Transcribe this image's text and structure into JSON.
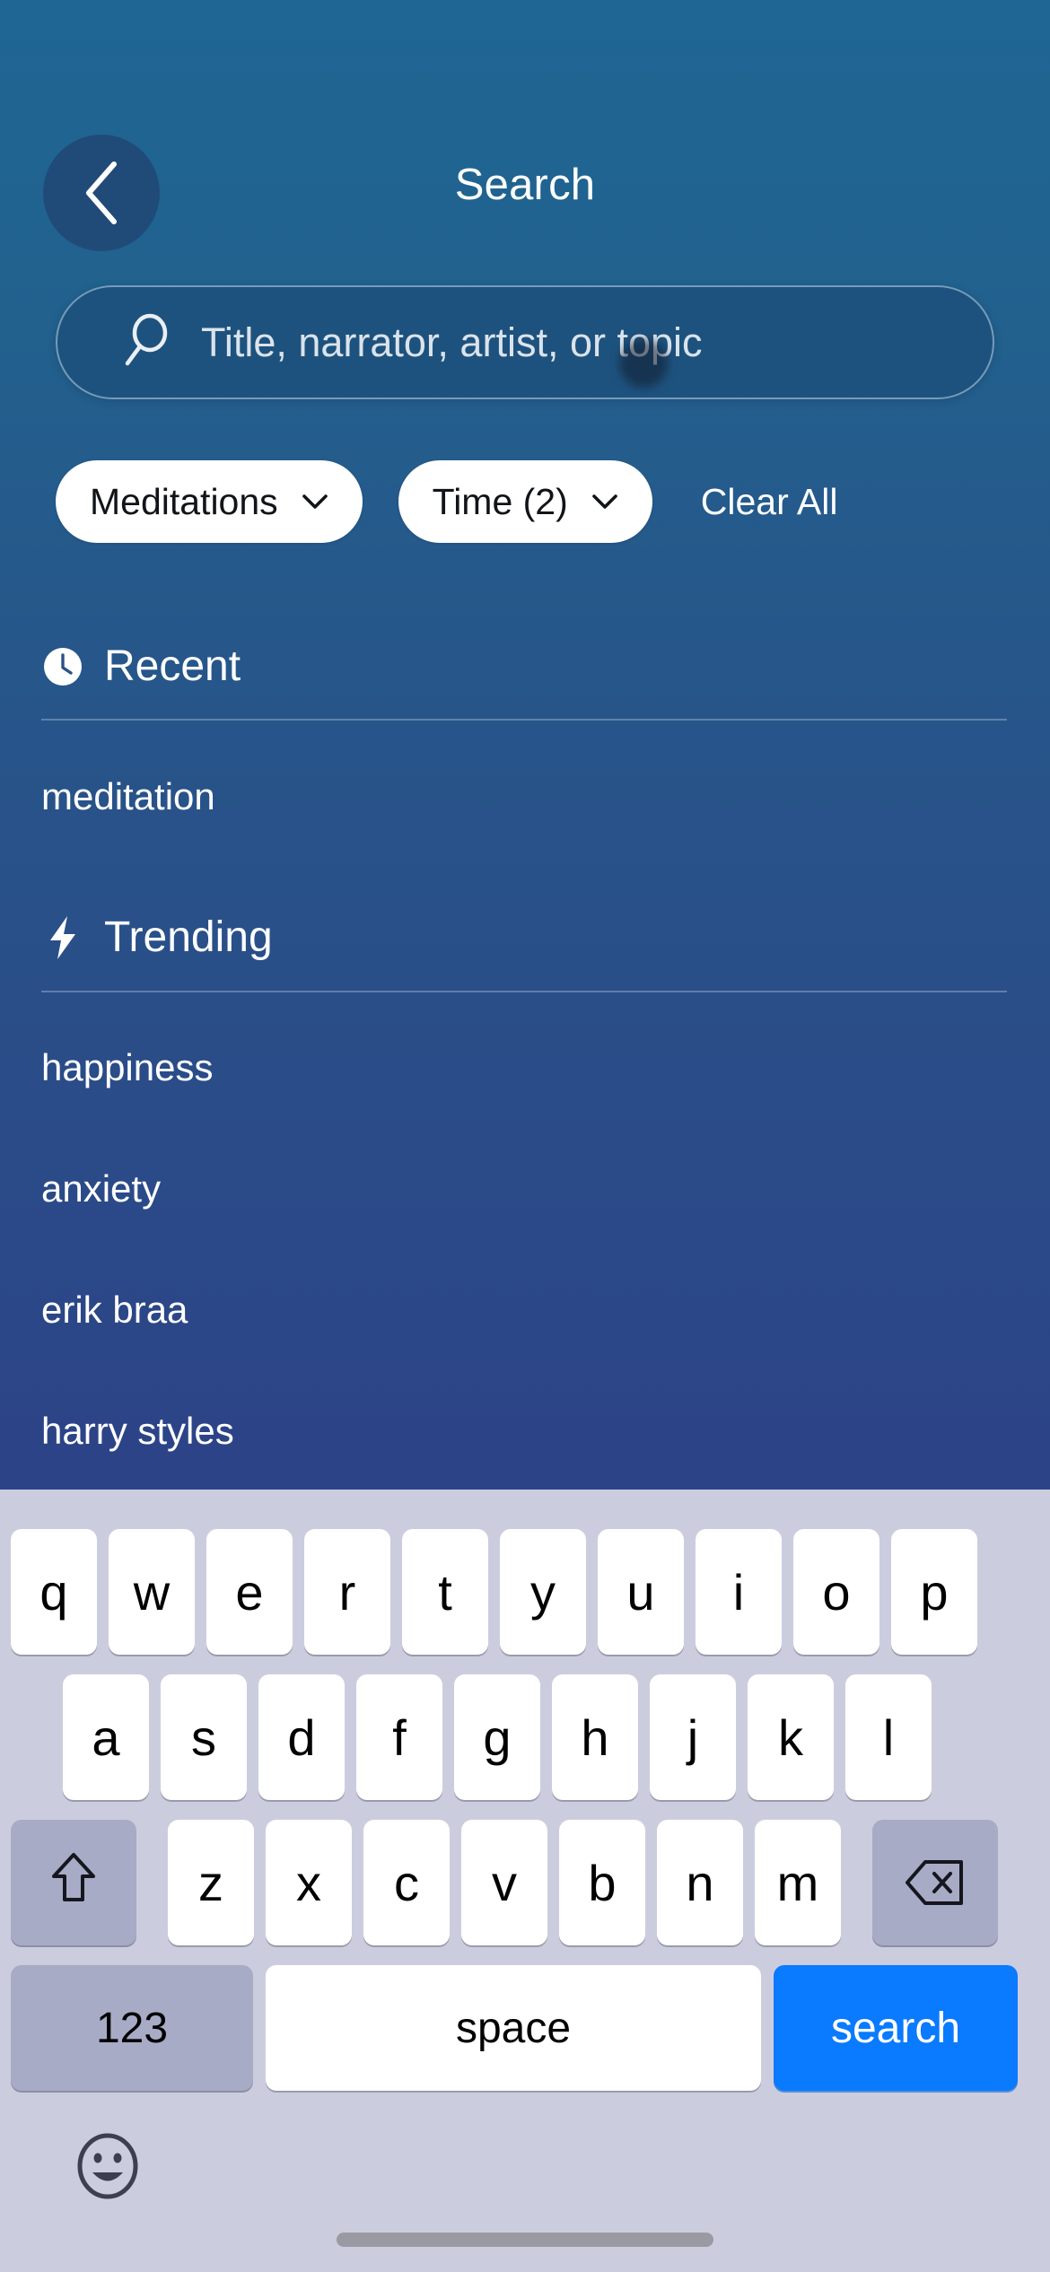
{
  "header": {
    "title": "Search",
    "back_icon": "chevron-left-icon"
  },
  "search": {
    "placeholder": "Title, narrator, artist, or topic",
    "value": "",
    "icon": "search-icon"
  },
  "filters": {
    "chips": [
      {
        "label": "Meditations",
        "caret_icon": "chevron-down-icon"
      },
      {
        "label": "Time (2)",
        "caret_icon": "chevron-down-icon"
      }
    ],
    "clear_all_label": "Clear All"
  },
  "recent": {
    "icon": "clock-icon",
    "title": "Recent",
    "items": [
      "meditation"
    ]
  },
  "trending": {
    "icon": "lightning-bolt-icon",
    "title": "Trending",
    "items": [
      "happiness",
      "anxiety",
      "erik braa",
      "harry styles"
    ]
  },
  "keyboard": {
    "row1": [
      "q",
      "w",
      "e",
      "r",
      "t",
      "y",
      "u",
      "i",
      "o",
      "p"
    ],
    "row2": [
      "a",
      "s",
      "d",
      "f",
      "g",
      "h",
      "j",
      "k",
      "l"
    ],
    "row3_letters": [
      "z",
      "x",
      "c",
      "v",
      "b",
      "n",
      "m"
    ],
    "shift_icon": "shift-arrow-icon",
    "backspace_icon": "backspace-icon",
    "numbers_label": "123",
    "space_label": "space",
    "return_label": "search",
    "emoji_icon": "smiley-face-icon"
  },
  "colors": {
    "gradient_top": "#1f6694",
    "gradient_bottom": "#2c4387",
    "search_field_bg": "#1e527e",
    "back_button_bg": "#204b79",
    "keyboard_bg": "#cbcddf",
    "key_bg": "#ffffff",
    "modifier_key_bg": "#a7abc6",
    "accent_key_bg": "#0a7afe",
    "chip_bg": "#ffffff",
    "text_light": "#ffffff",
    "home_indicator": "#9a9aa2"
  }
}
